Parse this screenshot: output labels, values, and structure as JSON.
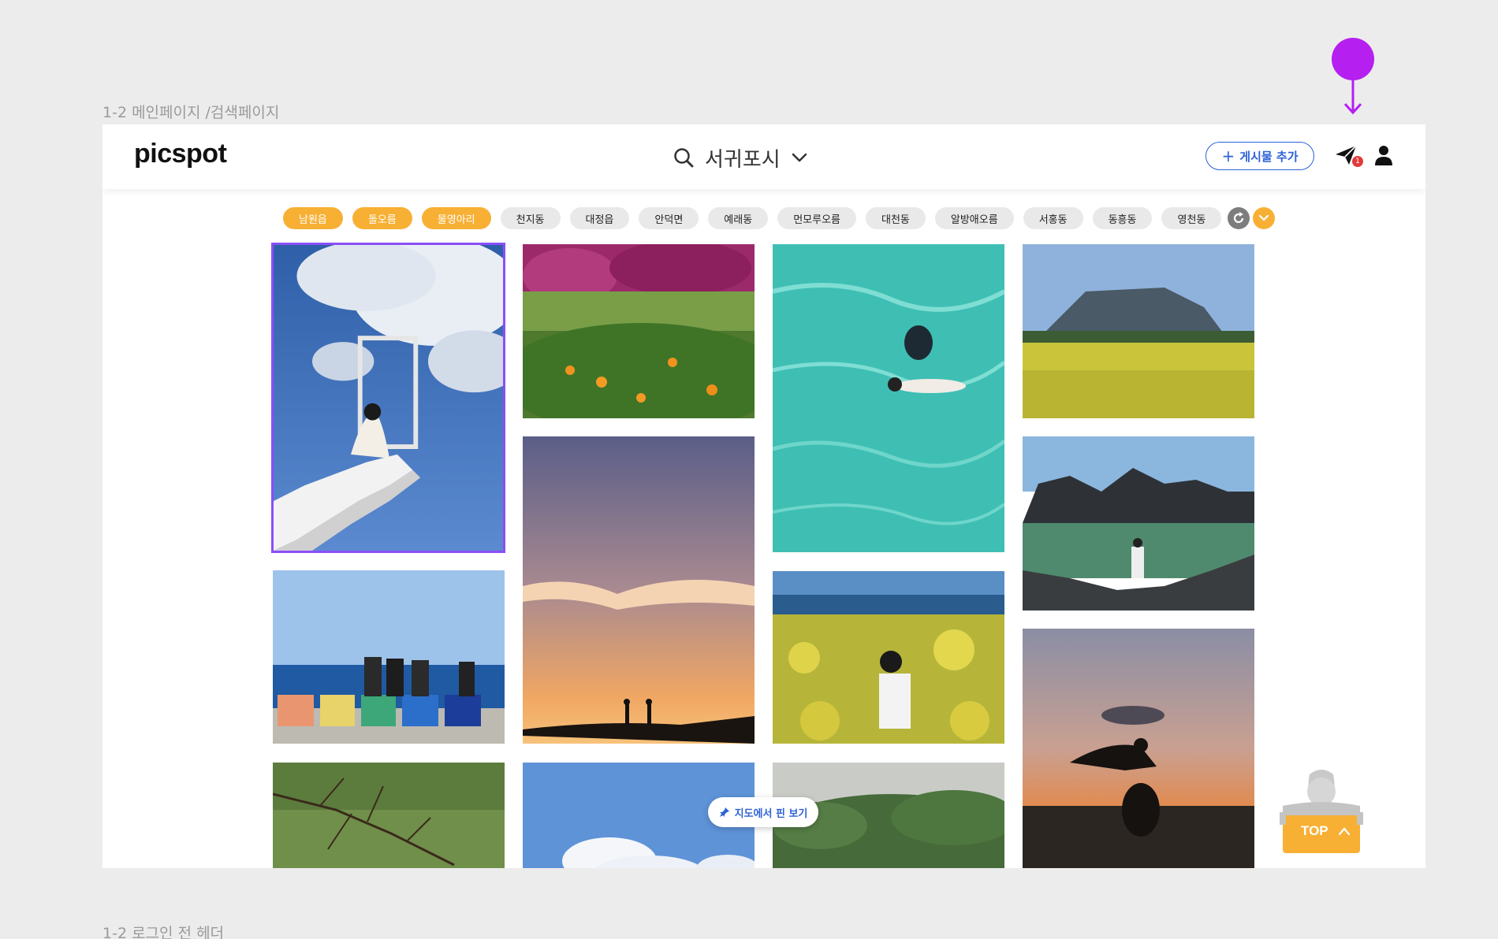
{
  "frame_labels": {
    "top": "1-2 메인페이지 /검색페이지",
    "bottom": "1-2 로그인 전 헤더"
  },
  "header": {
    "logo_text": "picspot",
    "search": {
      "location": "서귀포시",
      "icon": "search-icon",
      "dropdown_icon": "chevron-down-icon"
    },
    "add_post_label": "게시물 추가",
    "notification_count": "1"
  },
  "chips": [
    {
      "label": "남원읍",
      "active": true
    },
    {
      "label": "돌오름",
      "active": true
    },
    {
      "label": "물영아리",
      "active": true
    },
    {
      "label": "천지동",
      "active": false
    },
    {
      "label": "대정읍",
      "active": false
    },
    {
      "label": "안덕면",
      "active": false
    },
    {
      "label": "예래동",
      "active": false
    },
    {
      "label": "먼모루오름",
      "active": false
    },
    {
      "label": "대천동",
      "active": false
    },
    {
      "label": "알방애오름",
      "active": false
    },
    {
      "label": "서홍동",
      "active": false
    },
    {
      "label": "동흥동",
      "active": false
    },
    {
      "label": "영천동",
      "active": false
    }
  ],
  "photos": [
    {
      "subject": "woman on stairs with frame in sky",
      "selected": true
    },
    {
      "subject": "tangerine orchard with flowers"
    },
    {
      "subject": "swimmer in turquoise water"
    },
    {
      "subject": "mountain over canola field"
    },
    {
      "subject": "friends sitting on colorful blocks by sea"
    },
    {
      "subject": "couple silhouette at sunset"
    },
    {
      "subject": "rocky coast pool"
    },
    {
      "subject": "woman in canola field by sea"
    },
    {
      "subject": "tree branches over grass"
    },
    {
      "subject": "blue sky with clouds"
    },
    {
      "subject": "forest hillside"
    },
    {
      "subject": "infinity pool silhouette at sunset"
    }
  ],
  "map_pin_button": "지도에서 핀 보기",
  "top_button": "TOP",
  "colors": {
    "accent_orange": "#f7b034",
    "brand_blue": "#2d62d8",
    "selection_purple": "#8a4ff7",
    "marker_magenta": "#b51ff0"
  }
}
